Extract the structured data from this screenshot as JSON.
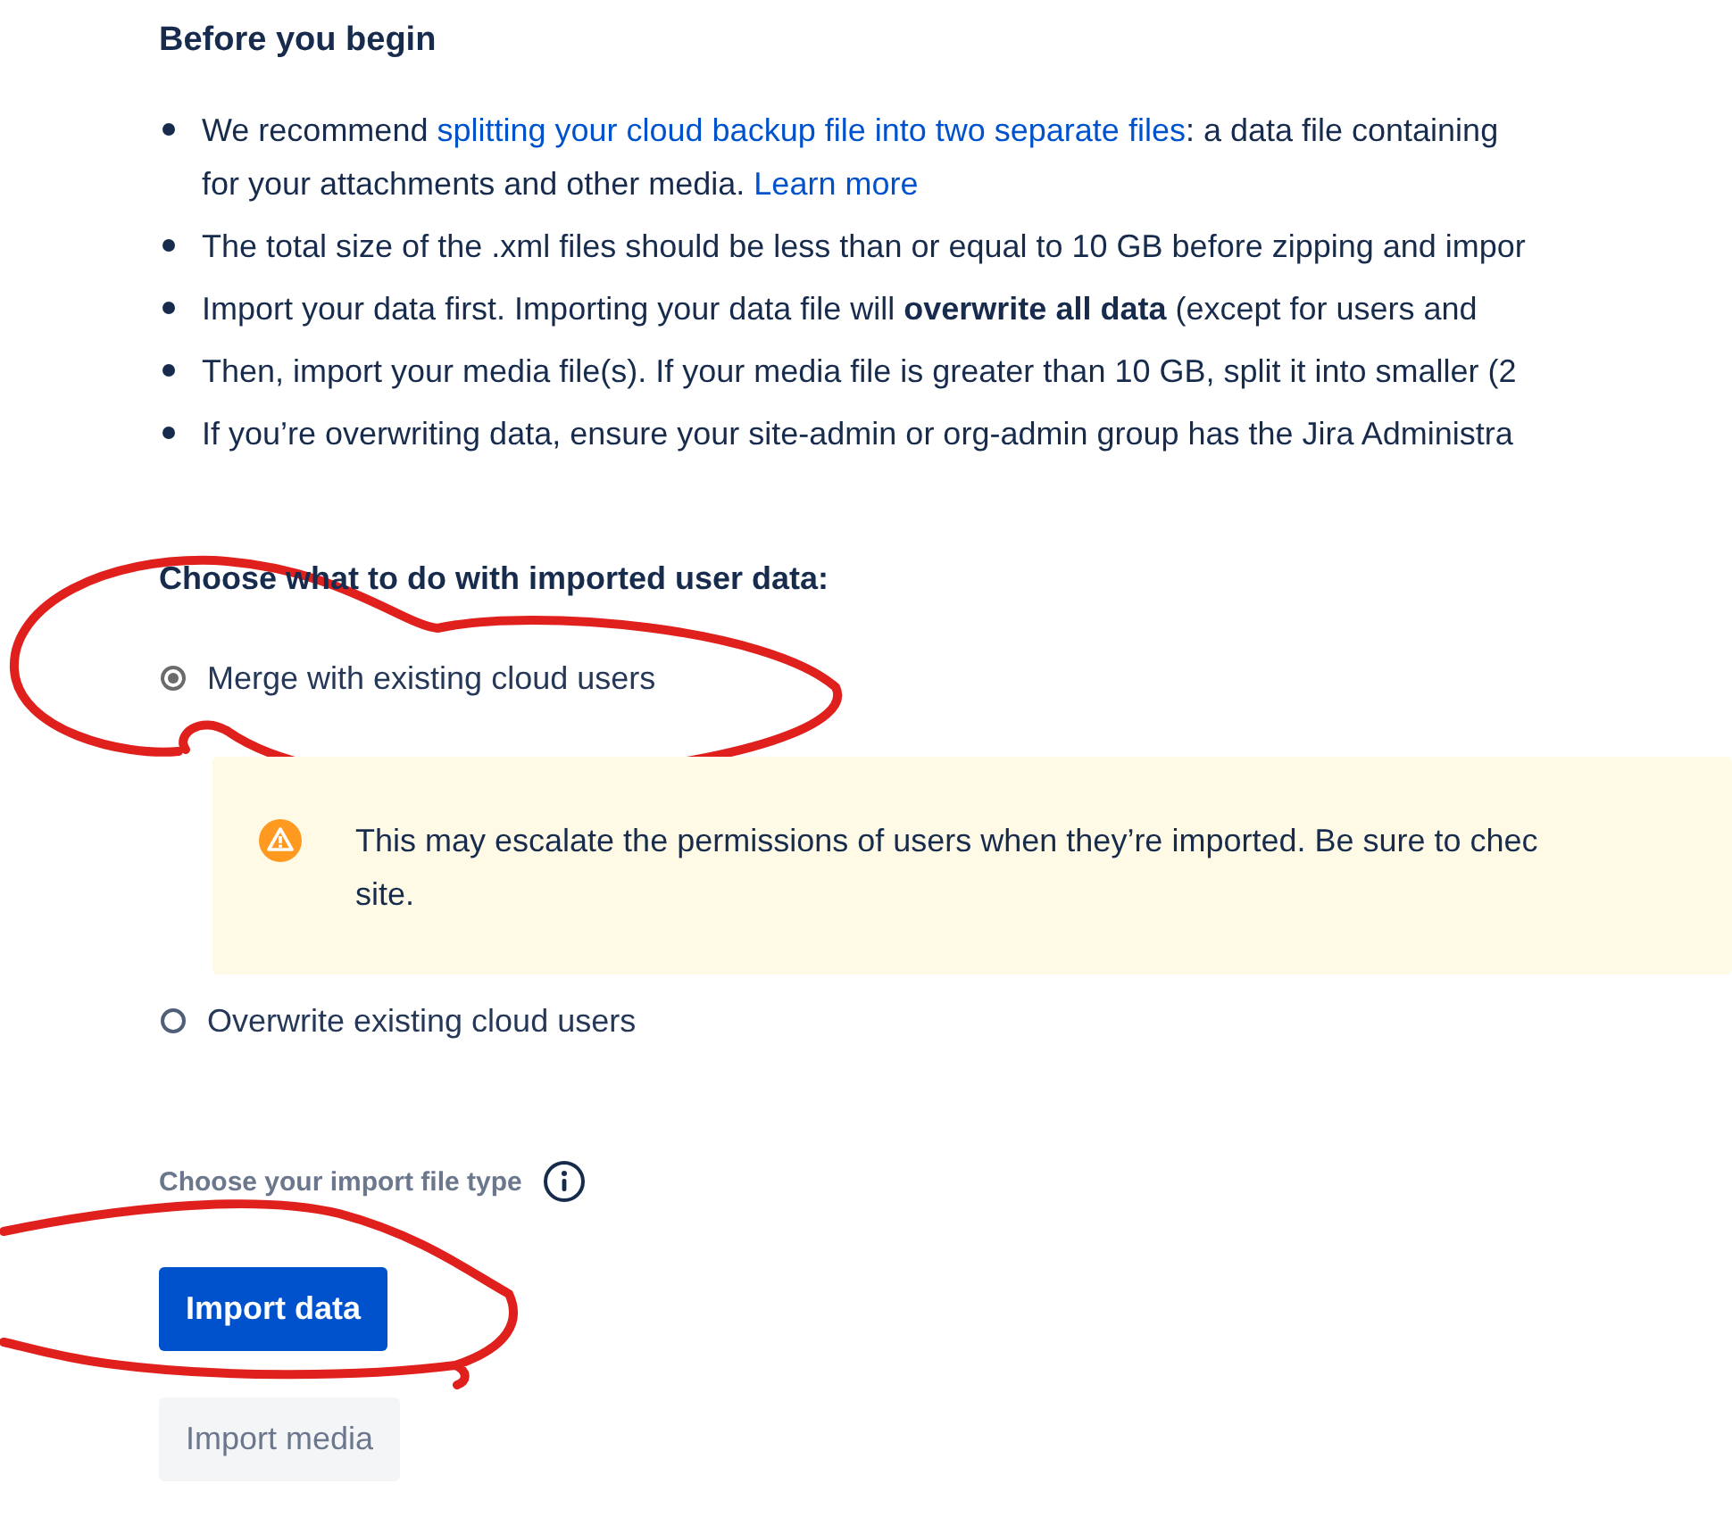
{
  "heading": "Before you begin",
  "bullets": [
    {
      "parts": [
        {
          "kind": "text",
          "text": "We recommend "
        },
        {
          "kind": "link",
          "text": "splitting your cloud backup file into two separate files"
        },
        {
          "kind": "text",
          "text": ": a data file containing"
        },
        {
          "kind": "break"
        },
        {
          "kind": "text",
          "text": "for your attachments and other media. "
        },
        {
          "kind": "link",
          "text": "Learn more"
        }
      ]
    },
    {
      "parts": [
        {
          "kind": "text",
          "text": "The total size of the .xml files should be less than or equal to 10 GB before zipping and impor"
        }
      ]
    },
    {
      "parts": [
        {
          "kind": "text",
          "text": "Import your data first. Importing your data file will **overwrite all data** (except for users and"
        }
      ]
    },
    {
      "parts": [
        {
          "kind": "text",
          "text": "Then, import your media file(s). If your media file is greater than 10 GB, split it into smaller (2"
        }
      ]
    },
    {
      "parts": [
        {
          "kind": "text",
          "text": "If you’re overwriting data, ensure your site-admin or org-admin group has the Jira Administra"
        }
      ]
    }
  ],
  "user_data": {
    "label": "Choose what to do with imported user data:",
    "options": [
      {
        "label": "Merge with existing cloud users",
        "selected": true,
        "warning": {
          "lines": [
            "This may escalate the permissions of users when they’re imported. Be sure to chec",
            "site."
          ]
        }
      },
      {
        "label": "Overwrite existing cloud users",
        "selected": false
      }
    ]
  },
  "file_type": {
    "label": "Choose your import file type"
  },
  "buttons": [
    {
      "label": "Import data",
      "kind": "primary",
      "disabled": false
    },
    {
      "label": "Import media",
      "kind": "default",
      "disabled": true
    }
  ]
}
